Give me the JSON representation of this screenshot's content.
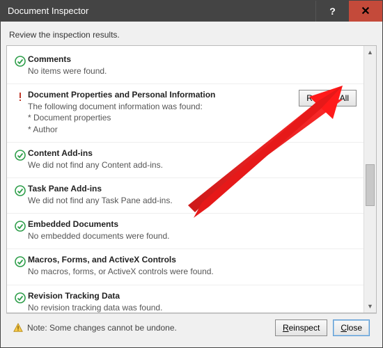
{
  "title": "Document Inspector",
  "instruction": "Review the inspection results.",
  "items": [
    {
      "status": "ok",
      "heading": "Comments",
      "desc": "No items were found.",
      "action": null
    },
    {
      "status": "warn",
      "heading": "Document Properties and Personal Information",
      "desc": "The following document information was found:\n* Document properties\n* Author",
      "action": "Remove All"
    },
    {
      "status": "ok",
      "heading": "Content Add-ins",
      "desc": "We did not find any Content add-ins.",
      "action": null
    },
    {
      "status": "ok",
      "heading": "Task Pane Add-ins",
      "desc": "We did not find any Task Pane add-ins.",
      "action": null
    },
    {
      "status": "ok",
      "heading": "Embedded Documents",
      "desc": "No embedded documents were found.",
      "action": null
    },
    {
      "status": "ok",
      "heading": "Macros, Forms, and ActiveX Controls",
      "desc": "No macros, forms, or ActiveX controls were found.",
      "action": null
    },
    {
      "status": "ok",
      "heading": "Revision Tracking Data",
      "desc": "No revision tracking data was found.",
      "action": null
    }
  ],
  "note": "Note: Some changes cannot be undone.",
  "buttons": {
    "reinspect": "Reinspect",
    "close": "Close"
  }
}
